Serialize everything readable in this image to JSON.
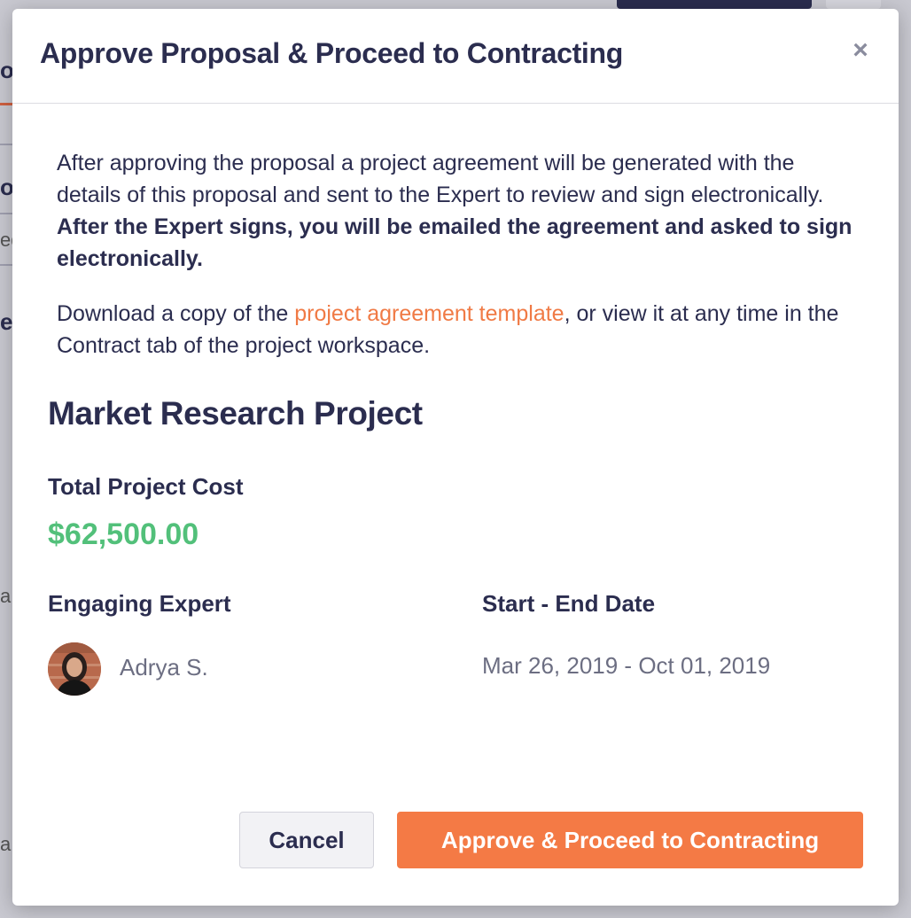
{
  "modal": {
    "title": "Approve Proposal & Proceed to Contracting",
    "close_label": "×",
    "description": {
      "text_1": "After approving the proposal a project agreement will be generated with the details of this proposal and sent to the Expert to review and sign electronically. ",
      "bold_text": "After the Expert signs, you will be emailed the agreement and asked to sign electronically.",
      "text_2_prefix": "Download a copy of the ",
      "link_label": "project agreement template",
      "text_2_suffix": ", or view it at any time in the Contract tab of the project workspace."
    },
    "project": {
      "title": "Market Research Project",
      "cost_label": "Total Project Cost",
      "cost_value": "$62,500.00",
      "expert_label": "Engaging Expert",
      "expert_name": "Adrya S.",
      "date_label": "Start - End Date",
      "date_value": "Mar 26, 2019 - Oct 01, 2019"
    },
    "buttons": {
      "cancel_label": "Cancel",
      "approve_label": "Approve & Proceed to Contracting"
    }
  },
  "background_fragments": {
    "frag_1": "o",
    "frag_2": "o",
    "frag_3": "eq",
    "frag_4": "e",
    "frag_5": "a",
    "frag_6": "a"
  },
  "colors": {
    "accent_orange": "#f47a45",
    "link_orange": "#f07a45",
    "cost_green": "#52c07a",
    "text_navy": "#2b2d4f"
  },
  "icons": {
    "close": "close-icon",
    "avatar": "expert-avatar"
  }
}
